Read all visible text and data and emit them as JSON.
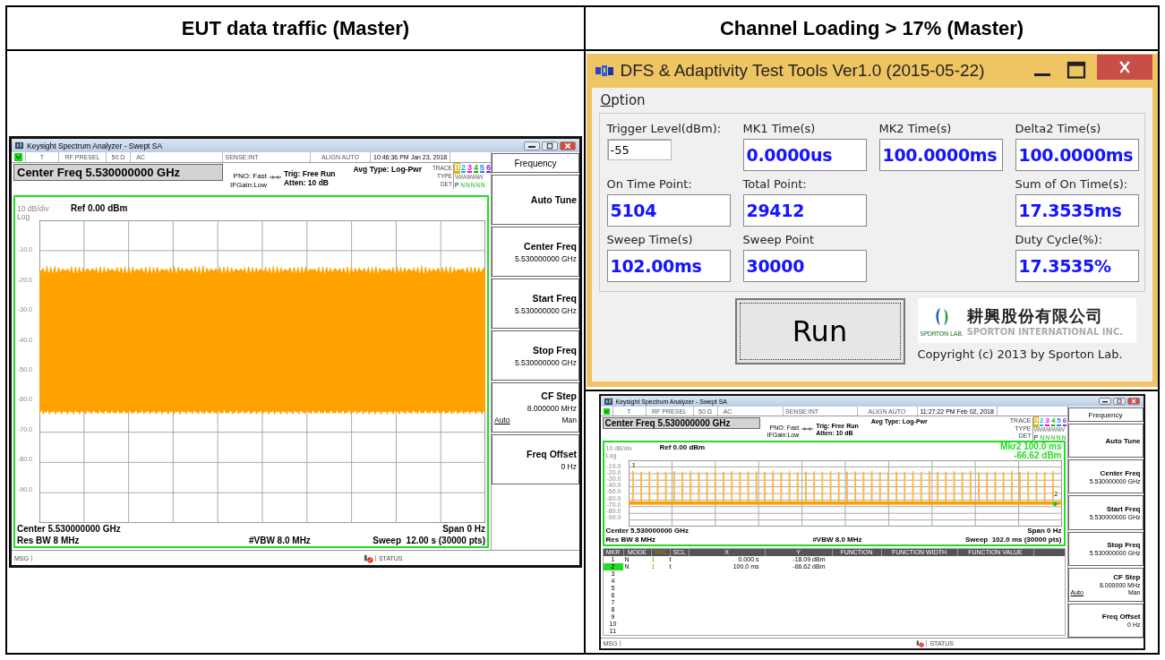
{
  "table": {
    "headers": [
      "EUT data traffic (Master)",
      "Channel Loading > 17% (Master)"
    ]
  },
  "analyzers": [
    {
      "title": "Keysight Spectrum Analyzer - Swept SA",
      "status": [
        "T",
        "RF PRESEL",
        "50 Ω",
        "AC",
        "SENSE:INT",
        "ALIGN AUTO"
      ],
      "time": "10:46:36 PM Jan 23, 2018",
      "center_freq": "Center Freq 5.530000000 GHz",
      "pno": [
        "PNO: Fast",
        "IFGain:Low"
      ],
      "trig": [
        "Trig: Free Run",
        "Atten: 10 dB"
      ],
      "avg_type": "Avg Type: Log-Pwr",
      "trace_panel": {
        "labels": [
          "TRACE",
          "TYPE",
          "DET"
        ],
        "traces": [
          {
            "num": "1",
            "color": "#d9b400"
          },
          {
            "num": "2",
            "color": "#00b7ff"
          },
          {
            "num": "3",
            "color": "#ff00ff"
          },
          {
            "num": "4",
            "color": "#00c000"
          },
          {
            "num": "5",
            "color": "#2f7bff"
          },
          {
            "num": "6",
            "color": "#8a2be2"
          }
        ],
        "type": "WWWWWW",
        "det_first": "P",
        "det_rest": "NNNNN"
      },
      "scale": "10 dB/div",
      "scale_type": "Log",
      "ref": "Ref 0.00 dBm",
      "y_labels": [
        "-10.0",
        "-20.0",
        "-30.0",
        "-40.0",
        "-50.0",
        "-60.0",
        "-70.0",
        "-80.0",
        "-90.0"
      ],
      "trace": {
        "kind": "noise"
      },
      "center": "Center 5.530000000 GHz",
      "span": "Span 0 Hz",
      "rbw": "Res BW 8 MHz",
      "vbw": "#VBW 8.0 MHz",
      "sweep": "Sweep  12.00 s (30000 pts)",
      "msg": "MSG",
      "status_label": "STATUS",
      "softkey_title": "Frequency",
      "softkeys": [
        {
          "label": "Auto Tune"
        },
        {
          "label": "Center Freq",
          "value": "5.530000000 GHz"
        },
        {
          "label": "Start Freq",
          "value": "5.530000000 GHz"
        },
        {
          "label": "Stop Freq",
          "value": "5.530000000 GHz"
        },
        {
          "label": "CF Step",
          "value": "8.000000 MHz",
          "options": [
            {
              "label": "Auto",
              "selected": true
            },
            {
              "label": "Man",
              "selected": false
            }
          ]
        },
        {
          "label": "Freq Offset",
          "value": "0 Hz"
        }
      ]
    },
    {
      "title": "Keysight Spectrum Analyzer - Swept SA",
      "status": [
        "T",
        "RF PRESEL",
        "50 Ω",
        "AC",
        "SENSE:INT",
        "ALIGN AUTO"
      ],
      "time": "11:27:22 PM Feb 02, 2018",
      "center_freq": "Center Freq 5.530000000 GHz",
      "pno": [
        "PNO: Fast",
        "IFGain:Low"
      ],
      "trig": [
        "Trig: Free Run",
        "Atten: 10 dB"
      ],
      "avg_type": "Avg Type: Log-Pwr",
      "trace_panel": {
        "labels": [
          "TRACE",
          "TYPE",
          "DET"
        ],
        "traces": [
          {
            "num": "1",
            "color": "#d9b400"
          },
          {
            "num": "2",
            "color": "#00b7ff"
          },
          {
            "num": "3",
            "color": "#ff00ff"
          },
          {
            "num": "4",
            "color": "#00c000"
          },
          {
            "num": "5",
            "color": "#2f7bff"
          },
          {
            "num": "6",
            "color": "#8a2be2"
          }
        ],
        "type": "WWWWWW",
        "det_first": "P",
        "det_rest": "NNNNN"
      },
      "marker_readout": [
        "Mkr2 100.0 ms",
        "-66.62 dBm"
      ],
      "marker_tags": [
        "1",
        "2"
      ],
      "scale": "10 dB/div",
      "scale_type": "Log",
      "ref": "Ref 0.00 dBm",
      "y_labels": [
        "-10.0",
        "-20.0",
        "-30.0",
        "-40.0",
        "-50.0",
        "-60.0",
        "-70.0",
        "-80.0",
        "-90.0"
      ],
      "trace": {
        "kind": "bursts"
      },
      "center": "Center 5.530000000 GHz",
      "span": "Span 0 Hz",
      "rbw": "Res BW 8 MHz",
      "vbw": "#VBW 8.0 MHz",
      "sweep": "Sweep  102.0 ms (30000 pts)",
      "marker_table": {
        "columns": [
          "MKR",
          "MODE",
          "TRC",
          "SCL",
          "X",
          "Y",
          "FUNCTION",
          "FUNCTION WIDTH",
          "FUNCTION VALUE"
        ],
        "rows": [
          {
            "cells": [
              "1",
              "N",
              "1",
              "t",
              "0.000 s",
              "-18.09 dBm"
            ],
            "selected": false
          },
          {
            "cells": [
              "2",
              "N",
              "1",
              "t",
              "100.0 ms",
              "-66.62 dBm"
            ],
            "selected": true
          },
          {
            "cells": [
              "3"
            ],
            "selected": false
          },
          {
            "cells": [
              "4"
            ],
            "selected": false
          },
          {
            "cells": [
              "5"
            ],
            "selected": false
          },
          {
            "cells": [
              "6"
            ],
            "selected": false
          },
          {
            "cells": [
              "7"
            ],
            "selected": false
          },
          {
            "cells": [
              "8"
            ],
            "selected": false
          },
          {
            "cells": [
              "9"
            ],
            "selected": false
          },
          {
            "cells": [
              "10"
            ],
            "selected": false
          },
          {
            "cells": [
              "11"
            ],
            "selected": false
          }
        ]
      },
      "msg": "MSG",
      "status_label": "STATUS",
      "softkey_title": "Frequency",
      "softkeys": [
        {
          "label": "Auto Tune"
        },
        {
          "label": "Center Freq",
          "value": "5.530000000 GHz"
        },
        {
          "label": "Start Freq",
          "value": "5.530000000 GHz"
        },
        {
          "label": "Stop Freq",
          "value": "5.530000000 GHz"
        },
        {
          "label": "CF Step",
          "value": "8.000000 MHz",
          "options": [
            {
              "label": "Auto",
              "selected": true
            },
            {
              "label": "Man",
              "selected": false
            }
          ]
        },
        {
          "label": "Freq Offset",
          "value": "0 Hz"
        }
      ]
    }
  ],
  "tool_window": {
    "title": "DFS & Adaptivity Test Tools Ver1.0 (2015-05-22)",
    "menu": [
      "Option"
    ],
    "rows": [
      [
        {
          "label": "Trigger Level(dBm):",
          "value": "-55",
          "kind": "input"
        },
        {
          "label": "MK1 Time(s)",
          "value": "0.0000us",
          "kind": "readout"
        },
        {
          "label": "MK2 Time(s)",
          "value": "100.0000ms",
          "kind": "readout"
        },
        {
          "label": "Delta2 Time(s)",
          "value": "100.0000ms",
          "kind": "readout"
        }
      ],
      [
        {
          "label": "On Time Point:",
          "value": "5104",
          "kind": "readout"
        },
        {
          "label": "Total Point:",
          "value": "29412",
          "kind": "readout"
        },
        {
          "label": "Sum of On Time(s):",
          "value": "17.3535ms",
          "kind": "readout"
        }
      ],
      [
        {
          "label": "Sweep Time(s)",
          "value": "102.00ms",
          "kind": "readout"
        },
        {
          "label": "Sweep Point",
          "value": "30000",
          "kind": "readout"
        },
        {
          "label": "Duty Cycle(%):",
          "value": "17.3535%",
          "kind": "readout"
        }
      ]
    ],
    "run_button": "Run",
    "logo": {
      "chinese": "耕興股份有限公司",
      "english": "SPORTON INTERNATIONAL INC.",
      "lab": "SPORTON LAB."
    },
    "copyright": "Copyright (c) 2013 by Sporton Lab."
  }
}
